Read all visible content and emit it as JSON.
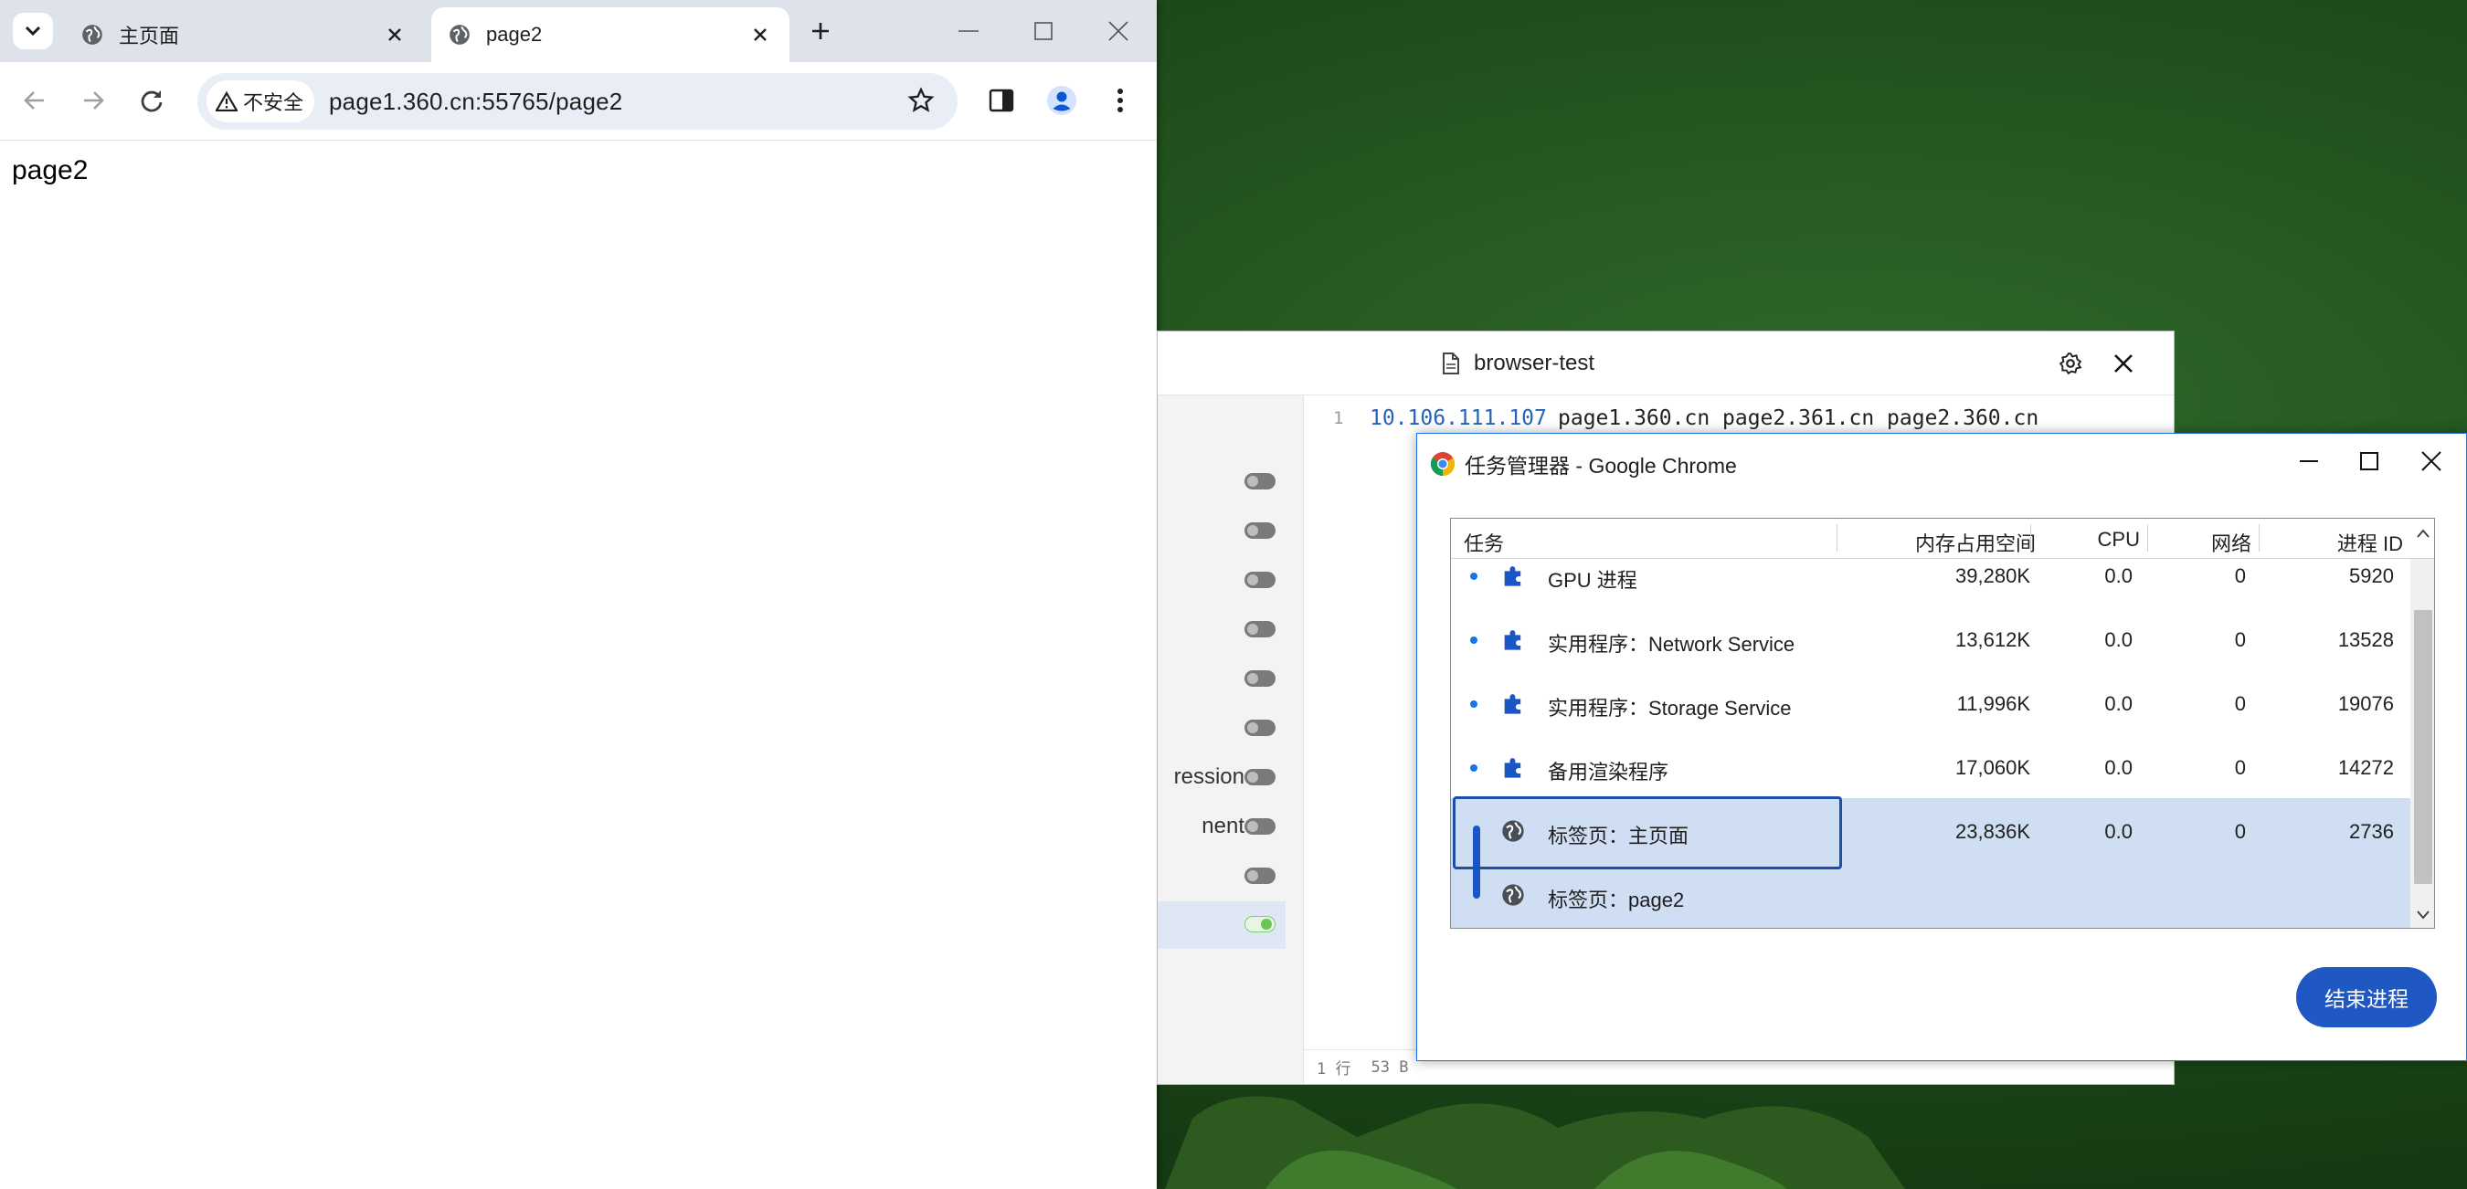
{
  "browser": {
    "tabs": [
      {
        "title": "主页面",
        "active": false
      },
      {
        "title": "page2",
        "active": true
      }
    ],
    "security_chip": "不安全",
    "url": "page1.360.cn:55765/page2",
    "page_text": "page2"
  },
  "editor": {
    "title": "browser-test",
    "sidebar_labels": [
      "ression",
      "nent"
    ],
    "code_line": {
      "number": "1",
      "ip": "10.106.111.107",
      "hosts": "page1.360.cn page2.361.cn page2.360.cn"
    },
    "status": {
      "line": "1 行",
      "bytes": "53 B"
    }
  },
  "task_manager": {
    "title": "任务管理器 - Google Chrome",
    "columns": [
      "任务",
      "内存占用空间",
      "CPU",
      "网络",
      "进程 ID"
    ],
    "rows": [
      {
        "name": "GPU 进程",
        "icon": "puzzle-icon",
        "memory": "39,280K",
        "cpu": "0.0",
        "network": "0",
        "pid": "5920",
        "selected": false
      },
      {
        "name": "实用程序：Network Service",
        "icon": "puzzle-icon",
        "memory": "13,612K",
        "cpu": "0.0",
        "network": "0",
        "pid": "13528",
        "selected": false
      },
      {
        "name": "实用程序：Storage Service",
        "icon": "puzzle-icon",
        "memory": "11,996K",
        "cpu": "0.0",
        "network": "0",
        "pid": "19076",
        "selected": false
      },
      {
        "name": "备用渲染程序",
        "icon": "puzzle-icon",
        "memory": "17,060K",
        "cpu": "0.0",
        "network": "0",
        "pid": "14272",
        "selected": false
      },
      {
        "name": "标签页：主页面",
        "icon": "globe-icon",
        "memory": "23,836K",
        "cpu": "0.0",
        "network": "0",
        "pid": "2736",
        "selected": true
      },
      {
        "name": "标签页：page2",
        "icon": "globe-icon",
        "memory": "",
        "cpu": "",
        "network": "",
        "pid": "",
        "selected": true
      }
    ],
    "end_process_label": "结束进程"
  },
  "colors": {
    "accent": "#1a73e8",
    "selection": "#cfdef3",
    "end_button": "#1f57c3"
  }
}
